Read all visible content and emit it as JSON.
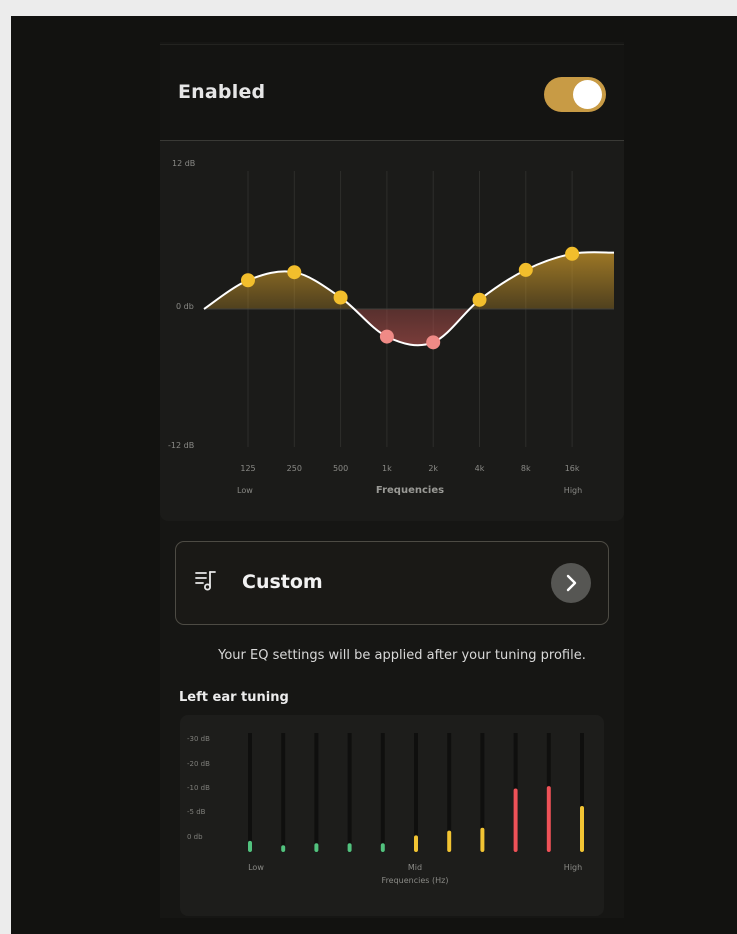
{
  "enabled": {
    "label": "Enabled",
    "on": true,
    "on_color": "#c89b45"
  },
  "eq_chart": {
    "y_labels": [
      "12 dB",
      "0 db",
      "-12 dB"
    ],
    "frequencies": [
      "125",
      "250",
      "500",
      "1k",
      "2k",
      "4k",
      "8k",
      "16k"
    ],
    "range_low": "Low",
    "range_high": "High",
    "axis_title": "Frequencies"
  },
  "preset": {
    "label": "Custom",
    "icon": "music-list-icon",
    "chevron": "chevron-right-icon"
  },
  "note": "Your EQ settings will be applied after your tuning profile.",
  "left_ear": {
    "title": "Left ear tuning",
    "y_labels": [
      "-30 dB",
      "-20 dB",
      "-10 dB",
      "-5 dB",
      "0 db"
    ],
    "x_low": "Low",
    "x_mid": "Mid",
    "x_high": "High",
    "x_title": "Frequencies (Hz)"
  },
  "chart_data": [
    {
      "type": "line",
      "categories": [
        "125",
        "250",
        "500",
        "1k",
        "2k",
        "4k",
        "8k",
        "16k"
      ],
      "series": [
        {
          "values": [
            2.5,
            3.2,
            1.0,
            -2.4,
            -2.9,
            0.8,
            3.4,
            4.8
          ]
        }
      ],
      "ylim": [
        -12,
        12
      ],
      "y_ticks": [
        "12 dB",
        "0 db",
        "-12 dB"
      ],
      "xlabel": "Frequencies",
      "x_range_labels": [
        "Low",
        "High"
      ],
      "colors": {
        "positive": "#f2be2c",
        "negative": "#ef8a86",
        "curve": "#ffffff"
      }
    },
    {
      "type": "bar",
      "title": "Left ear tuning",
      "bar_count": 11,
      "values": [
        2.8,
        1.7,
        2.2,
        2.2,
        2.2,
        4.2,
        5.4,
        6.1,
        16.0,
        16.6,
        11.6
      ],
      "levels": [
        "low",
        "low",
        "low",
        "low",
        "low",
        "mid",
        "mid",
        "mid",
        "high",
        "high",
        "mid"
      ],
      "ylim": [
        0,
        30
      ],
      "y_ticks": [
        "-30 dB",
        "-20 dB",
        "-10 dB",
        "-5 dB",
        "0 db"
      ],
      "xlabel": "Frequencies (Hz)",
      "x_markers": [
        "Low",
        "Mid",
        "High"
      ],
      "colors": {
        "low": "#52c27e",
        "mid": "#f2c433",
        "high": "#ef5258",
        "track": "#0f0f0e"
      }
    }
  ]
}
